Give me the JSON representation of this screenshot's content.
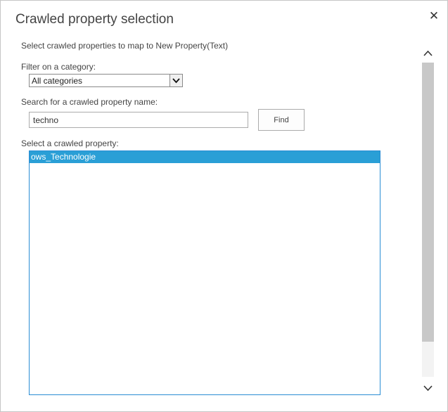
{
  "dialog": {
    "title": "Crawled property selection",
    "close_icon": "close-icon"
  },
  "form": {
    "instructions": "Select crawled properties to map to New Property(Text)",
    "category_label": "Filter on a category:",
    "category_value": "All categories",
    "search_label": "Search for a crawled property name:",
    "search_value": "techno",
    "find_button": "Find",
    "list_label": "Select a crawled property:",
    "list_items": [
      "ows_Technologie"
    ]
  },
  "colors": {
    "selection": "#2a9fd6",
    "list_border": "#2a8dd4"
  }
}
